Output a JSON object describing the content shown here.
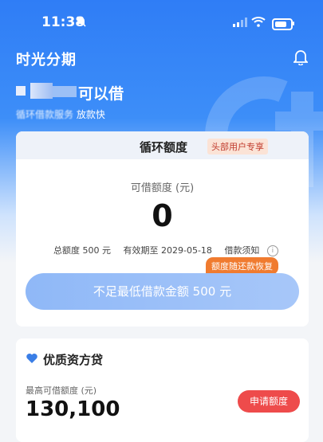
{
  "status_bar": {
    "time": "11:38"
  },
  "app": {
    "title": "时光分期"
  },
  "hero": {
    "headline": "可以借",
    "subline_blurred": "循环借款服务",
    "subline_clear": "放款快"
  },
  "credit_card": {
    "title": "循环额度",
    "badge": "头部用户专享",
    "available_label": "可借额度 (元)",
    "available_amount": "0",
    "total_limit": "总额度 500 元",
    "valid_until": "有效期至 2029-05-18",
    "notice_link": "借款须知",
    "info_icon": "i",
    "restore_tag": "额度随还款恢复",
    "main_button": "不足最低借款金额 500 元"
  },
  "quality_card": {
    "title": "优质资方贷",
    "max_label": "最高可借额度 (元)",
    "max_amount": "130,100",
    "apply_button": "申请额度"
  },
  "colors": {
    "brand_blue": "#2f7df6",
    "orange": "#f07b2f",
    "red": "#ee4b4b"
  }
}
